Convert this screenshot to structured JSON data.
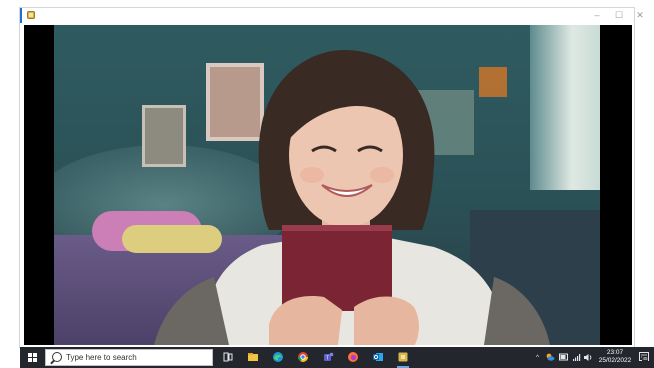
{
  "window": {
    "controls": {
      "minimize": "–",
      "maximize": "☐",
      "close": "✕"
    }
  },
  "taskbar": {
    "search_placeholder": "Type here to search",
    "pinned": [
      "task-view-icon",
      "file-explorer-icon",
      "edge-icon",
      "chrome-icon",
      "teams-icon",
      "firefox-icon",
      "outlook-icon",
      "media-player-icon"
    ],
    "tray_chevron": "^",
    "clock": {
      "time": "23:07",
      "date": "25/02/2022"
    },
    "notification_count": "45"
  },
  "colors": {
    "taskbar_bg": "#23262c",
    "accent": "#1f6fd1",
    "video_bg": "#000000"
  }
}
